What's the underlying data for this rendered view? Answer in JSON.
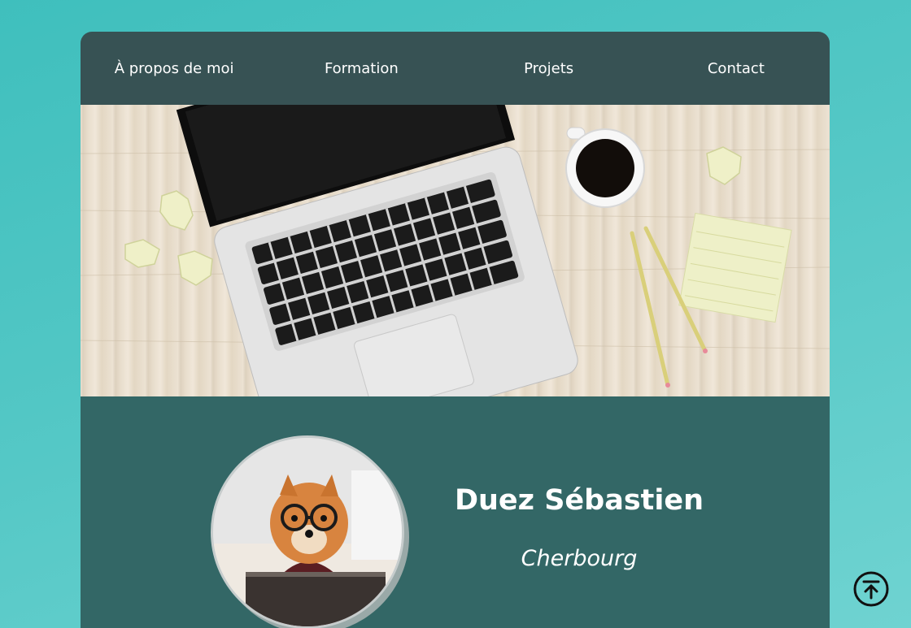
{
  "nav": {
    "items": [
      {
        "label": "À propos de moi"
      },
      {
        "label": "Formation"
      },
      {
        "label": "Projets"
      },
      {
        "label": "Contact"
      }
    ]
  },
  "profile": {
    "name": "Duez Sébastien",
    "city": "Cherbourg"
  },
  "icons": {
    "scroll_top": "arrow-up-circle-icon"
  },
  "colors": {
    "background": "#4cc4c2",
    "nav_bg": "#375254",
    "profile_bg": "#336766",
    "text": "#ffffff"
  }
}
